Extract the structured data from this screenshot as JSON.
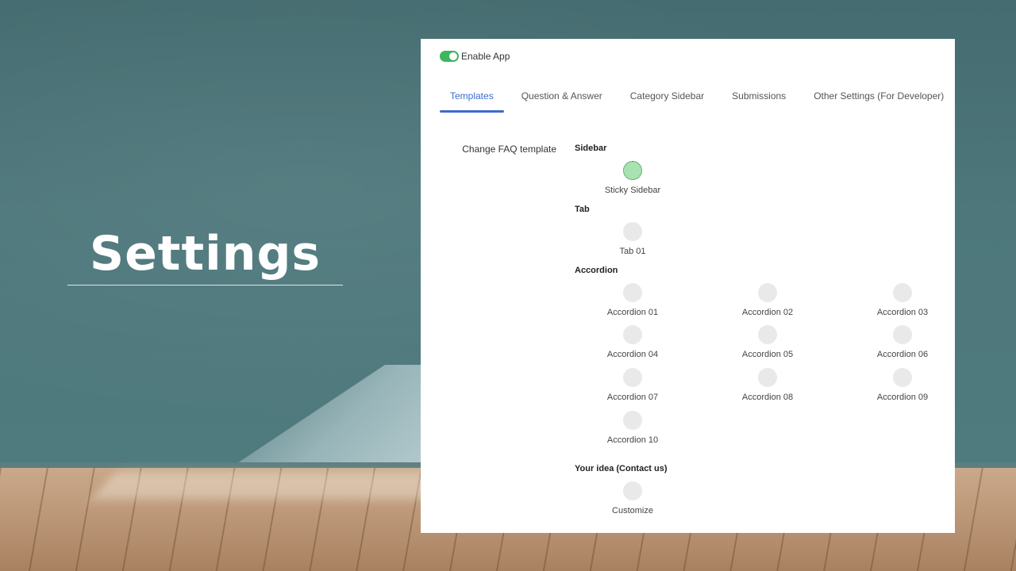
{
  "hero": {
    "title": "Settings"
  },
  "panel": {
    "enable_app": {
      "label": "Enable App",
      "on": true
    },
    "tabs": [
      {
        "label": "Templates",
        "active": true
      },
      {
        "label": "Question & Answer",
        "active": false
      },
      {
        "label": "Category Sidebar",
        "active": false
      },
      {
        "label": "Submissions",
        "active": false
      },
      {
        "label": "Other Settings (For Developer)",
        "active": false
      }
    ],
    "field_label": "Change FAQ template",
    "sections": {
      "sidebar": {
        "title": "Sidebar",
        "options": [
          "Sticky Sidebar"
        ]
      },
      "tab": {
        "title": "Tab",
        "options": [
          "Tab 01"
        ]
      },
      "accordion": {
        "title": "Accordion",
        "options": [
          "Accordion 01",
          "Accordion 02",
          "Accordion 03",
          "Accordion 04",
          "Accordion 05",
          "Accordion 06",
          "Accordion 07",
          "Accordion 08",
          "Accordion 09",
          "Accordion 10"
        ]
      },
      "idea": {
        "title": "Your idea (Contact us)",
        "options": [
          "Customize"
        ]
      }
    },
    "selected": "Sticky Sidebar"
  },
  "colors": {
    "accent": "#3d6bce",
    "toggle_on": "#3eb55f",
    "selected_radio": "#a7e3b0"
  }
}
